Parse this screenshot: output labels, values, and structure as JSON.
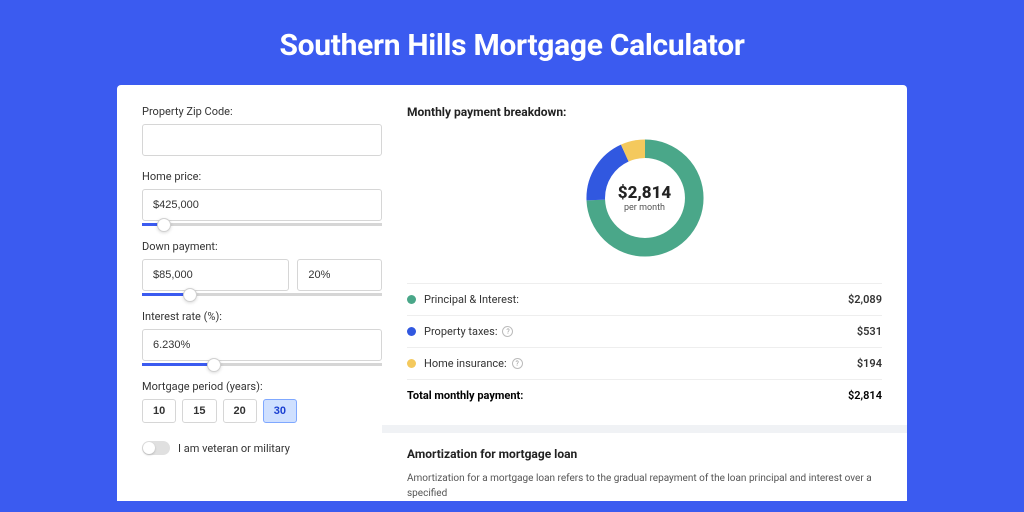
{
  "title": "Southern Hills Mortgage Calculator",
  "form": {
    "zip": {
      "label": "Property Zip Code:",
      "value": ""
    },
    "home_price": {
      "label": "Home price:",
      "value": "$425,000",
      "slider_pct": 9
    },
    "down_payment": {
      "label": "Down payment:",
      "amount": "$85,000",
      "percent": "20%",
      "slider_pct": 20
    },
    "interest_rate": {
      "label": "Interest rate (%):",
      "value": "6.230%",
      "slider_pct": 30
    },
    "period": {
      "label": "Mortgage period (years):",
      "options": [
        "10",
        "15",
        "20",
        "30"
      ],
      "selected": "30"
    },
    "veteran": {
      "label": "I am veteran or military",
      "on": false
    }
  },
  "breakdown": {
    "title": "Monthly payment breakdown:",
    "center_amount": "$2,814",
    "center_label": "per month",
    "items": [
      {
        "label": "Principal & Interest:",
        "value": "$2,089",
        "color": "#4aa789",
        "help": false
      },
      {
        "label": "Property taxes:",
        "value": "$531",
        "color": "#3158e0",
        "help": true
      },
      {
        "label": "Home insurance:",
        "value": "$194",
        "color": "#f4c95d",
        "help": true
      }
    ],
    "total": {
      "label": "Total monthly payment:",
      "value": "$2,814"
    }
  },
  "chart_data": {
    "type": "pie",
    "title": "Monthly payment breakdown",
    "series": [
      {
        "name": "Principal & Interest",
        "value": 2089,
        "color": "#4aa789"
      },
      {
        "name": "Property taxes",
        "value": 531,
        "color": "#3158e0"
      },
      {
        "name": "Home insurance",
        "value": 194,
        "color": "#f4c95d"
      }
    ],
    "total": 2814,
    "center_text": "$2,814 per month"
  },
  "amortization": {
    "title": "Amortization for mortgage loan",
    "text": "Amortization for a mortgage loan refers to the gradual repayment of the loan principal and interest over a specified"
  }
}
